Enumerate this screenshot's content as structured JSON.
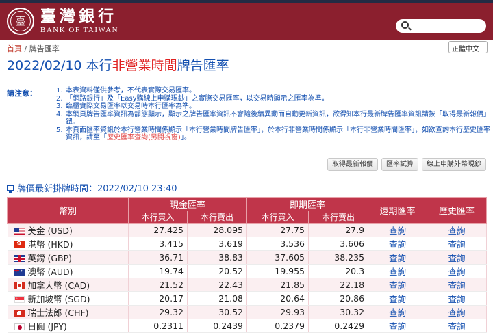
{
  "header": {
    "logo_cn": "臺灣銀行",
    "logo_en": "BANK OF TAIWAN",
    "seal_glyph": "臺"
  },
  "breadcrumb": {
    "home": "首頁",
    "separator": " / ",
    "current": "牌告匯率"
  },
  "language_select": {
    "value": "正體中文"
  },
  "page_title": {
    "prefix": "2022/02/10 本行",
    "highlight": "非營業時間",
    "suffix": "牌告匯率"
  },
  "notes": {
    "label": "請注意：",
    "items": [
      {
        "num": "1.",
        "text": "本表資料僅供參考，不代表實際交易匯率。"
      },
      {
        "num": "2.",
        "text": "「網路銀行」及「Easy購線上申購現鈔」之實際交易匯率，以交易時顯示之匯率為準。"
      },
      {
        "num": "3.",
        "text": "臨櫃實際交易匯率以交易時本行匯率為準。"
      },
      {
        "num": "4.",
        "text": "本網頁牌告匯率資訊為靜態顯示，顯示之牌告匯率資訊不會隨後續異動而自動更新資訊，欲得知本行最新牌告匯率資訊請按「取得最新報價」鈕。"
      },
      {
        "num": "5.",
        "text_before": "本頁面匯率資訊於本行營業時間係顯示「本行營業時間牌告匯率」，於本行非營業時間係顯示「本行非營業時間匯率」，如欲查詢本行歷史匯率資訊，請至「",
        "link": "歷史匯率查詢(另開視窗)",
        "text_after": "」。"
      }
    ]
  },
  "buttons": {
    "latest_quote": "取得最新報價",
    "calculator": "匯率試算",
    "online_buy": "線上申購外幣現鈔"
  },
  "quote_time": "牌價最新掛牌時間：2022/02/10 23:40",
  "table": {
    "headers": {
      "currency": "幣別",
      "cash_rate": "現金匯率",
      "spot_rate": "即期匯率",
      "forward_rate": "遠期匯率",
      "history_rate": "歷史匯率",
      "buy": "本行買入",
      "sell": "本行賣出"
    },
    "rows": [
      {
        "flag": "us",
        "currency": "美金 (USD)",
        "cash_buy": "27.425",
        "cash_sell": "28.095",
        "spot_buy": "27.75",
        "spot_sell": "27.9",
        "forward": "查詢",
        "history": "查詢"
      },
      {
        "flag": "hk",
        "currency": "港幣 (HKD)",
        "cash_buy": "3.415",
        "cash_sell": "3.619",
        "spot_buy": "3.536",
        "spot_sell": "3.606",
        "forward": "查詢",
        "history": "查詢"
      },
      {
        "flag": "gb",
        "currency": "英鎊 (GBP)",
        "cash_buy": "36.71",
        "cash_sell": "38.83",
        "spot_buy": "37.605",
        "spot_sell": "38.235",
        "forward": "查詢",
        "history": "查詢"
      },
      {
        "flag": "au",
        "currency": "澳幣 (AUD)",
        "cash_buy": "19.74",
        "cash_sell": "20.52",
        "spot_buy": "19.955",
        "spot_sell": "20.3",
        "forward": "查詢",
        "history": "查詢"
      },
      {
        "flag": "ca",
        "currency": "加拿大幣 (CAD)",
        "cash_buy": "21.52",
        "cash_sell": "22.43",
        "spot_buy": "21.85",
        "spot_sell": "22.18",
        "forward": "查詢",
        "history": "查詢"
      },
      {
        "flag": "sg",
        "currency": "新加坡幣 (SGD)",
        "cash_buy": "20.17",
        "cash_sell": "21.08",
        "spot_buy": "20.64",
        "spot_sell": "20.86",
        "forward": "查詢",
        "history": "查詢"
      },
      {
        "flag": "ch",
        "currency": "瑞士法郎 (CHF)",
        "cash_buy": "29.32",
        "cash_sell": "30.52",
        "spot_buy": "29.93",
        "spot_sell": "30.32",
        "forward": "查詢",
        "history": "查詢"
      },
      {
        "flag": "jp",
        "currency": "日圓 (JPY)",
        "cash_buy": "0.2311",
        "cash_sell": "0.2439",
        "spot_buy": "0.2379",
        "spot_sell": "0.2429",
        "forward": "查詢",
        "history": "查詢"
      }
    ]
  },
  "colors": {
    "brand": "#8b1f2e",
    "table_header": "#c0354a",
    "title_blue": "#1450b0",
    "highlight_red": "#e02020"
  }
}
